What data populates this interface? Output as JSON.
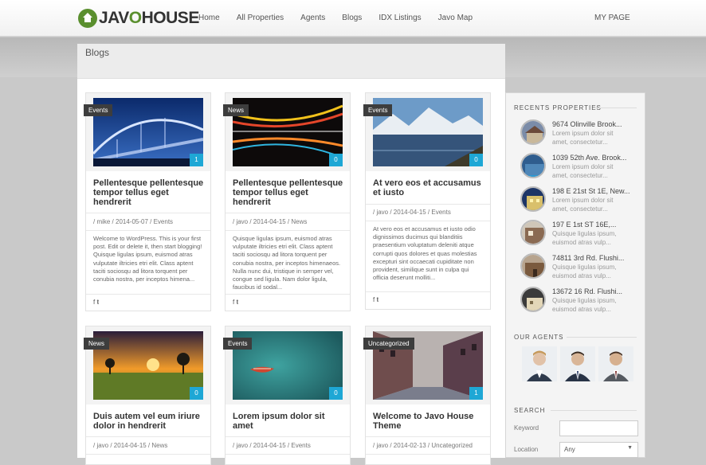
{
  "header": {
    "logo_left": "JAV",
    "logo_o": "O",
    "logo_right": "HOUSE",
    "nav": [
      "Home",
      "All Properties",
      "Agents",
      "Blogs",
      "IDX Listings",
      "Javo Map"
    ],
    "my_page": "MY PAGE"
  },
  "page": {
    "title": "Blogs"
  },
  "posts": [
    {
      "category": "Events",
      "count": "1",
      "title": "Pellentesque pellentesque tempor tellus eget hendrerit",
      "meta": "/ mike / 2014-05-07 / Events",
      "excerpt": "Welcome to WordPress. This is your first post. Edit or delete it, then start blogging!  Quisque ligulas ipsum, euismod atras vulputate iltricies etri elit. Class aptent taciti sociosqu ad litora torquent per conubia nostra, per inceptos himena...",
      "social": "f 𝐭"
    },
    {
      "category": "News",
      "count": "0",
      "title": "Pellentesque pellentesque tempor tellus eget hendrerit",
      "meta": "/ javo / 2014-04-15 / News",
      "excerpt": "Quisque ligulas ipsum, euismod atras vulputate iltricies etri elit. Class aptent taciti sociosqu ad litora torquent per conubia nostra, per inceptos himenaeos. Nulla nunc dui, tristique in semper vel, congue sed ligula. Nam dolor ligula, faucibus id sodal...",
      "social": "f 𝐭"
    },
    {
      "category": "Events",
      "count": "0",
      "title": "At vero eos et accusamus et iusto",
      "meta": "/ javo / 2014-04-15 / Events",
      "excerpt": "At vero eos et accusamus et iusto odio dignissimos ducimus qui blanditiis praesentium voluptatum deleniti atque corrupti quos dolores et quas molestias excepturi sint occaecati cupiditate non provident, similique sunt in culpa qui officia deserunt molliti...",
      "social": "f 𝐭"
    },
    {
      "category": "News",
      "count": "0",
      "title": "Duis autem vel eum iriure dolor in hendrerit",
      "meta": "/ javo / 2014-04-15 / News"
    },
    {
      "category": "Events",
      "count": "0",
      "title": "Lorem ipsum dolor sit amet",
      "meta": "/ javo / 2014-04-15 / Events"
    },
    {
      "category": "Uncategorized",
      "count": "1",
      "title": "Welcome to Javo House Theme",
      "meta": "/ javo / 2014-02-13 / Uncategorized"
    }
  ],
  "sidebar": {
    "recent_heading": "RECENTS PROPERTIES",
    "properties": [
      {
        "title": "9674 Olinville Brook...",
        "desc": "Lorem ipsum dolor sit amet, consectetur..."
      },
      {
        "title": "1039 52th Ave. Brook...",
        "desc": "Lorem ipsum dolor sit amet, consectetur..."
      },
      {
        "title": "198 E 21st St 1E, New...",
        "desc": "Lorem ipsum dolor sit amet, consectetur..."
      },
      {
        "title": "197 E 1st ST 16E,...",
        "desc": "Quisque ligulas ipsum, euismod atras vulp..."
      },
      {
        "title": "74811 3rd Rd. Flushi...",
        "desc": "Quisque ligulas ipsum, euismod atras vulp..."
      },
      {
        "title": "13672 16 Rd. Flushi...",
        "desc": "Quisque ligulas ipsum, euismod atras vulp..."
      }
    ],
    "agents_heading": "OUR AGENTS",
    "search_heading": "SEARCH",
    "keyword_label": "Keyword",
    "keyword_value": "",
    "location_label": "Location",
    "location_value": "Any"
  }
}
